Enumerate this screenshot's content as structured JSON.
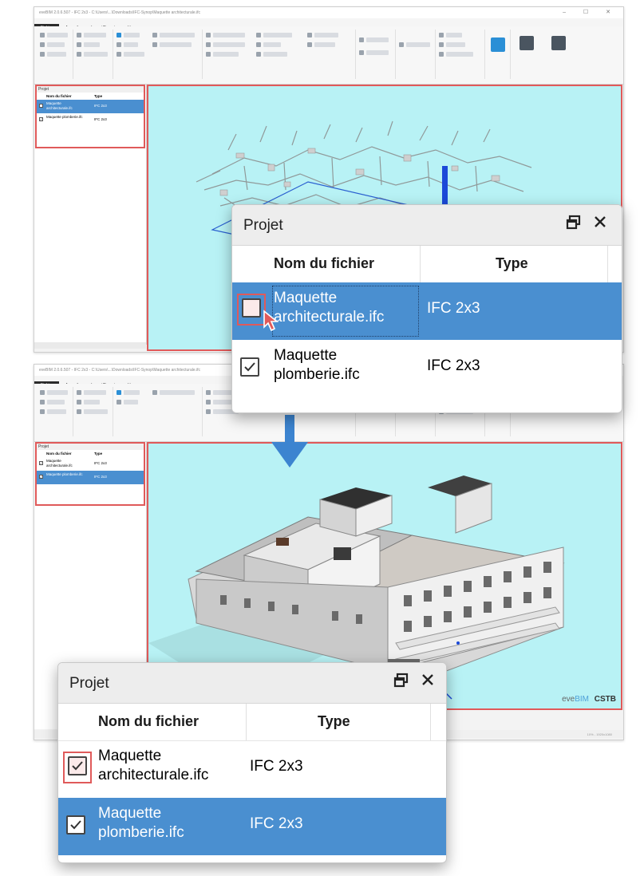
{
  "app": {
    "title": "eveBIM 2.0.6.507 - IFC 2x3 - C:\\Users\\...\\Downloads\\IFC-Synop\\Maquette architecturale.ifc",
    "title2": "eveBIM 2.0.6.507 - IFC 2x3 - C:\\Users\\...\\Downloads\\IFC-Synop\\Maquette architecturale.ifc",
    "window_controls": "–  ☐  ✕",
    "menu": [
      "Fichier",
      "Accueil",
      "Import/Export",
      "Vue"
    ],
    "status_text": "10% - 1920x1080"
  },
  "watermark": {
    "eve": "eve",
    "bim": "BIM",
    "cstb": "CSTB"
  },
  "colors": {
    "highlight_red": "#e05a5a",
    "selection_blue": "#4a8fd0",
    "viewport_cyan": "#b8f2f5",
    "arrow_blue": "#3c84d0"
  },
  "mini_panel_top": {
    "title": "Projet",
    "col_name": "Nom du fichier",
    "col_type": "Type",
    "rows": [
      {
        "name": "Maquette architecturale.ifc",
        "type": "IFC 2x3",
        "checked": false,
        "selected": true
      },
      {
        "name": "Maquette plomberie.ifc",
        "type": "IFC 2x3",
        "checked": true,
        "selected": false
      }
    ]
  },
  "mini_panel_bottom": {
    "title": "Projet",
    "col_name": "Nom du fichier",
    "col_type": "Type",
    "rows": [
      {
        "name": "Maquette architecturale.ifc",
        "type": "IFC 2x3",
        "checked": true,
        "selected": false
      },
      {
        "name": "Maquette plomberie.ifc",
        "type": "IFC 2x3",
        "checked": true,
        "selected": true
      }
    ]
  },
  "zoom_panel_top": {
    "title": "Projet",
    "col_name": "Nom du fichier",
    "col_type": "Type",
    "row1_name_l1": "Maquette",
    "row1_name_l2": "architecturale.ifc",
    "row1_type": "IFC 2x3",
    "row2_name_l1": "Maquette",
    "row2_name_l2": "plomberie.ifc",
    "row2_type": "IFC 2x3",
    "row1_checked": false,
    "row2_checked": true,
    "selected_row": 1
  },
  "zoom_panel_bottom": {
    "title": "Projet",
    "col_name": "Nom du fichier",
    "col_type": "Type",
    "row1_name_l1": "Maquette",
    "row1_name_l2": "architecturale.ifc",
    "row1_type": "IFC 2x3",
    "row2_name_l1": "Maquette",
    "row2_name_l2": "plomberie.ifc",
    "row2_type": "IFC 2x3",
    "row1_checked": true,
    "row2_checked": true,
    "selected_row": 2
  },
  "icons": {
    "restore": "restore-icon",
    "close": "close-icon",
    "check": "check-icon",
    "cursor": "cursor-icon",
    "arrow": "arrow-down-icon"
  }
}
